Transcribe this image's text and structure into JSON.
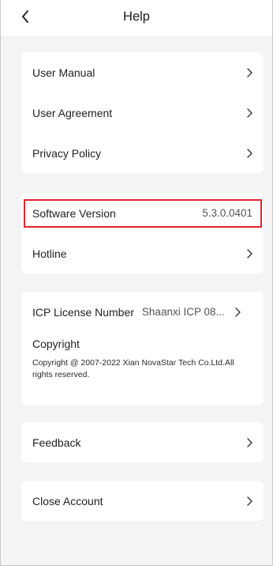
{
  "header": {
    "title": "Help"
  },
  "group1": [
    {
      "label": "User Manual"
    },
    {
      "label": "User Agreement"
    },
    {
      "label": "Privacy Policy"
    }
  ],
  "group2": {
    "version": {
      "label": "Software Version",
      "value": "5.3.0.0401"
    },
    "hotline": {
      "label": "Hotline"
    }
  },
  "group3": {
    "icp": {
      "label": "ICP License Number",
      "value": "Shaanxi ICP 08..."
    },
    "copyright_title": "Copyright",
    "copyright_text": "Copyright @ 2007-2022 Xian NovaStar Tech Co.Ltd.All rights reserved."
  },
  "group4": {
    "label": "Feedback"
  },
  "group5": {
    "label": "Close Account"
  },
  "colors": {
    "highlight": "#e0262a",
    "background": "#f4f4f6",
    "card": "#ffffff"
  }
}
